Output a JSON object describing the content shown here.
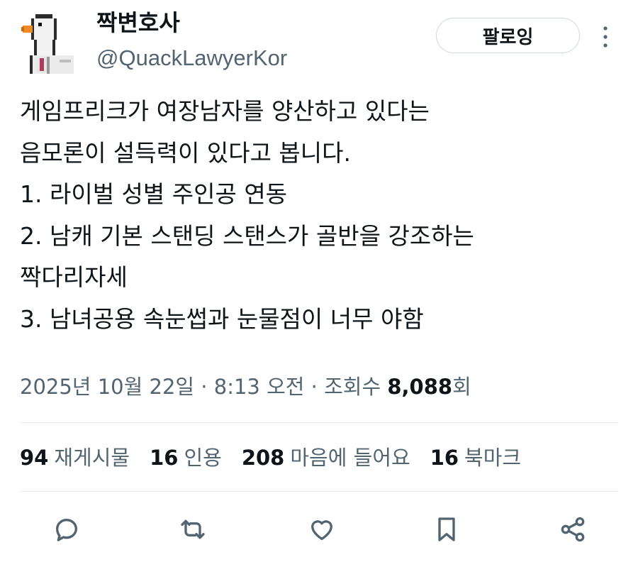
{
  "author": {
    "display_name": "짝변호사",
    "handle": "@QuackLawyerKor",
    "avatar_icon": "goose-avatar-icon"
  },
  "follow_button": {
    "label": "팔로잉"
  },
  "more_icon": "more-vertical-icon",
  "tweet": {
    "lines": [
      "게임프리크가 여장남자를 양산하고 있다는",
      "음모론이 설득력이 있다고 봅니다.",
      "1. 라이벌 성별 주인공 연동",
      "2. 남캐 기본 스탠딩 스탠스가 골반을 강조하는",
      "짝다리자세",
      "3. 남녀공용 속눈썹과 눈물점이 너무 야함"
    ]
  },
  "meta": {
    "timestamp": "2025년 10월 22일 · 8:13 오전 · 조회수 ",
    "views_count": "8,088",
    "views_suffix": "회"
  },
  "stats": [
    {
      "count": "94",
      "label": "재게시물"
    },
    {
      "count": "16",
      "label": "인용"
    },
    {
      "count": "208",
      "label": "마음에 들어요"
    },
    {
      "count": "16",
      "label": "북마크"
    }
  ],
  "actions": [
    {
      "icon": "reply-icon"
    },
    {
      "icon": "repost-icon"
    },
    {
      "icon": "like-icon"
    },
    {
      "icon": "bookmark-icon"
    },
    {
      "icon": "share-icon"
    }
  ],
  "colors": {
    "text": "#0f1419",
    "secondary": "#536471",
    "border": "#cfd9de"
  }
}
